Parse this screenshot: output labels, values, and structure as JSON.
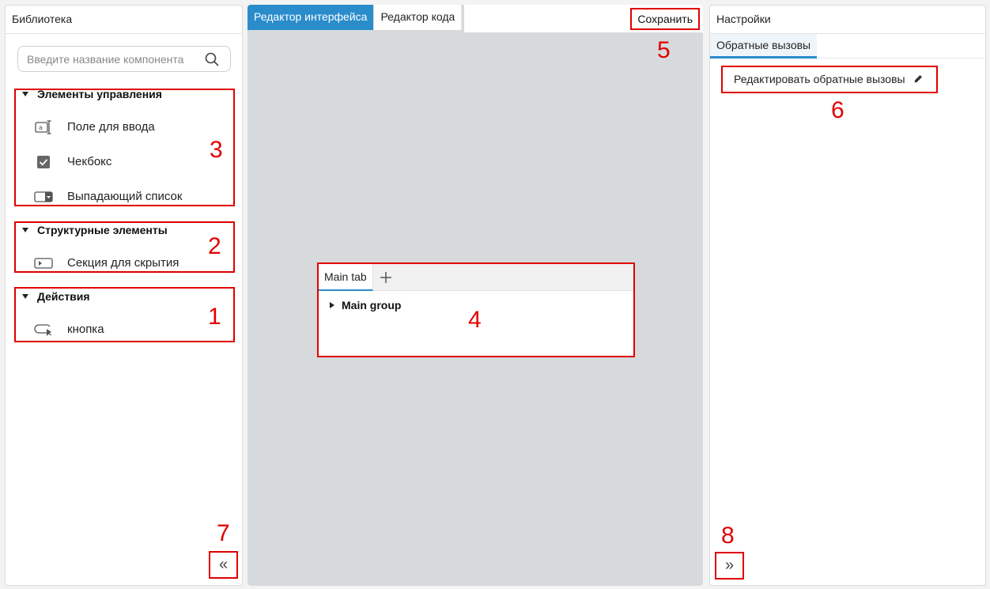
{
  "library": {
    "title": "Библиотека",
    "search_placeholder": "Введите название компонента",
    "sections": [
      {
        "title": "Элементы управления",
        "items": [
          {
            "label": "Поле для ввода",
            "icon": "text-input-icon"
          },
          {
            "label": "Чекбокс",
            "icon": "checkbox-icon"
          },
          {
            "label": "Выпадающий список",
            "icon": "dropdown-icon"
          }
        ]
      },
      {
        "title": "Структурные элементы",
        "items": [
          {
            "label": "Секция для скрытия",
            "icon": "collapsible-section-icon"
          }
        ]
      },
      {
        "title": "Действия",
        "items": [
          {
            "label": "кнопка",
            "icon": "button-icon"
          }
        ]
      }
    ],
    "collapse_label": "«"
  },
  "editor": {
    "tabs": [
      "Редактор интерфейса",
      "Редактор кода"
    ],
    "save_label": "Сохранить",
    "canvas": {
      "tab_label": "Main tab",
      "add_tab_label": "+",
      "group_label": "Main group"
    }
  },
  "settings": {
    "title": "Настройки",
    "tab": "Обратные вызовы",
    "edit_callbacks_label": "Редактировать обратные вызовы",
    "expand_label": "»"
  },
  "annotations": [
    "1",
    "2",
    "3",
    "4",
    "5",
    "6",
    "7",
    "8"
  ],
  "colors": {
    "accent": "#2a8ccb",
    "annotation": "#e00000",
    "canvas_bg": "#d7dadd"
  }
}
